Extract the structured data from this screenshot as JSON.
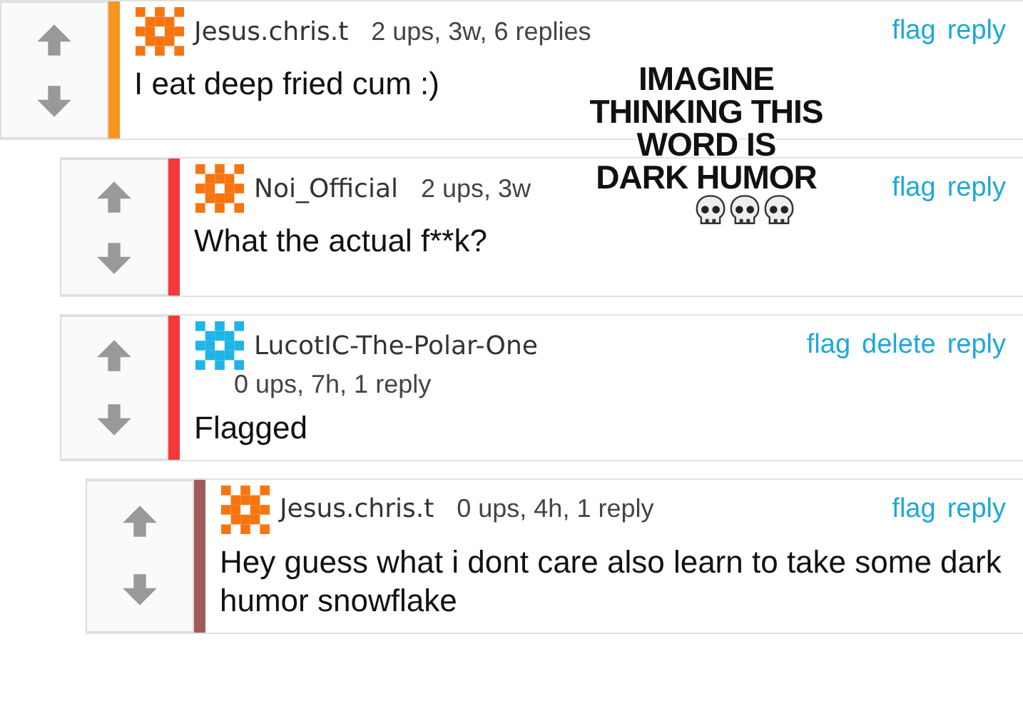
{
  "comments": [
    {
      "user": "Jesus.chris.t",
      "meta": "2 ups, 3w, 6 replies",
      "meta_below": false,
      "links": [
        "flag",
        "reply"
      ],
      "body": "I eat deep fried cum :)",
      "color": "#f7941d",
      "avatar": {
        "color": "#f7750f"
      },
      "children": [
        {
          "user": "Noi_Official",
          "meta": "2 ups, 3w",
          "meta_below": false,
          "links": [
            "flag",
            "reply"
          ],
          "body": "What the actual f**k?",
          "color": "#f5393a",
          "avatar": {
            "color": "#f7750f"
          }
        },
        {
          "user": "LucotIC-The-Polar-One",
          "meta": "0 ups, 7h, 1 reply",
          "meta_below": true,
          "links": [
            "flag",
            "delete",
            "reply"
          ],
          "body": "Flagged",
          "color": "#f5393a",
          "avatar": {
            "color": "#1fb4e8"
          },
          "children": [
            {
              "user": "Jesus.chris.t",
              "meta": "0 ups, 4h, 1 reply",
              "meta_below": false,
              "links": [
                "flag",
                "reply"
              ],
              "body": "Hey guess what i dont care also learn to take some dark humor snowflake",
              "color": "#a05a5a",
              "avatar": {
                "color": "#f7750f"
              }
            }
          ]
        }
      ]
    }
  ],
  "caption": {
    "text": "IMAGINE THINKING THIS WORD IS DARK HUMOR"
  }
}
